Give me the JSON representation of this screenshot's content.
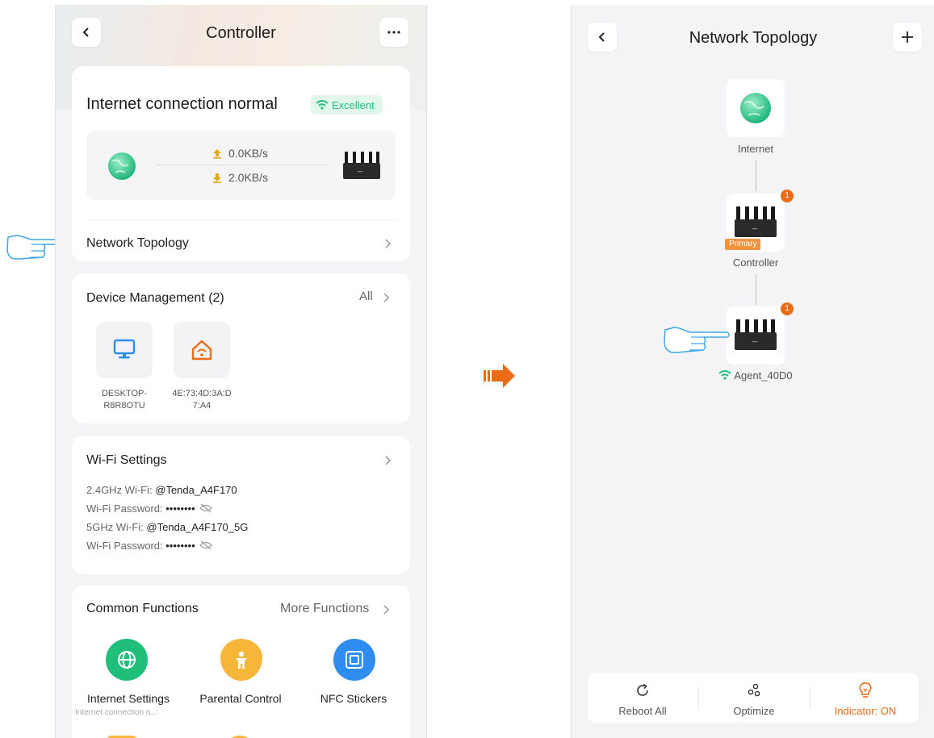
{
  "controller": {
    "title": "Controller",
    "status": {
      "text": "Internet connection normal",
      "quality": "Excellent"
    },
    "speed": {
      "upload": "0.0KB/s",
      "download": "2.0KB/s"
    },
    "topology_label": "Network Topology",
    "devices": {
      "title": "Device Management (2)",
      "all": "All",
      "items": [
        {
          "name_line1": "DESKTOP-",
          "name_line2": "R8R8OTU",
          "icon": "monitor-icon"
        },
        {
          "name_line1": "4E:73:4D:3A:D",
          "name_line2": "7:A4",
          "icon": "smart-home-icon"
        }
      ]
    },
    "wifi": {
      "title": "Wi-Fi Settings",
      "rows": [
        {
          "label": "2.4GHz Wi-Fi:",
          "value": "@Tenda_A4F170"
        },
        {
          "label": "Wi-Fi Password:",
          "value": "••••••••"
        },
        {
          "label": "5GHz Wi-Fi:",
          "value": "@Tenda_A4F170_5G"
        },
        {
          "label": "Wi-Fi Password:",
          "value": "••••••••"
        }
      ]
    },
    "functions": {
      "title": "Common Functions",
      "more": "More Functions",
      "items": [
        {
          "label": "Internet Settings",
          "sub": "Internet connection n...",
          "icon": "globe-icon",
          "color": "#1fbf7a"
        },
        {
          "label": "Parental Control",
          "icon": "child-shield-icon",
          "color": "#f5b63a"
        },
        {
          "label": "NFC Stickers",
          "icon": "nfc-icon",
          "color": "#2f8cf0"
        }
      ]
    }
  },
  "topology": {
    "title": "Network Topology",
    "nodes": [
      {
        "label": "Internet"
      },
      {
        "label": "Controller",
        "tag": "Primary",
        "badge": "1"
      },
      {
        "label": "Agent_40D0",
        "badge": "1"
      }
    ],
    "actions": [
      {
        "label": "Reboot All",
        "icon": "reboot-icon"
      },
      {
        "label": "Optimize",
        "icon": "optimize-icon"
      },
      {
        "label": "Indicator: ON",
        "icon": "bulb-icon",
        "color": "#ec6b16"
      }
    ]
  },
  "colors": {
    "accent_orange": "#ec6b16",
    "accent_green": "#1fbf7a",
    "hand_outline": "#3fa6e6"
  }
}
